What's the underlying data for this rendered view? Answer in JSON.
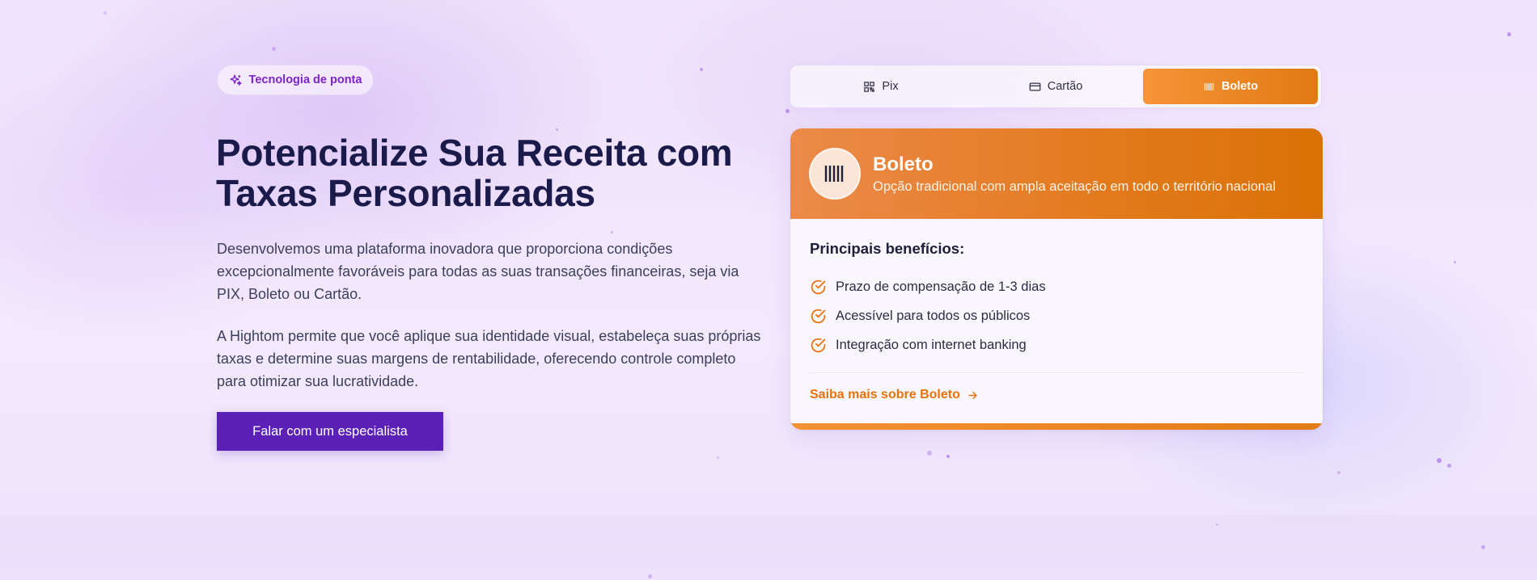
{
  "hero": {
    "badge": "Tecnologia de ponta",
    "title": "Potencialize Sua Receita com Taxas Personalizadas",
    "paragraph_1": "Desenvolvemos uma plataforma inovadora que proporciona condições excepcionalmente favoráveis para todas as suas transações financeiras, seja via PIX, Boleto ou Cartão.",
    "paragraph_2": "A Hightom permite que você aplique sua identidade visual, estabeleça suas próprias taxas e determine suas margens de rentabilidade, oferecendo controle completo para otimizar sua lucratividade.",
    "cta_label": "Falar com um especialista",
    "cta_color": "#5b21b6"
  },
  "payment_tabs": [
    {
      "label": "Pix",
      "icon": "qr-code-icon",
      "active": false
    },
    {
      "label": "Cartão",
      "icon": "credit-card-icon",
      "active": false
    },
    {
      "label": "Boleto",
      "icon": "barcode-icon",
      "active": true
    }
  ],
  "method_card": {
    "icon": "barcode-icon",
    "title": "Boleto",
    "subtitle": "Opção tradicional com ampla aceitação em todo o território nacional",
    "benefits_heading": "Principais benefícios:",
    "benefits": [
      "Prazo de compensação de 1-3 dias",
      "Acessível para todos os públicos",
      "Integração com internet banking"
    ],
    "link_label": "Saiba mais sobre Boleto",
    "accent_color": "#e8720c"
  }
}
